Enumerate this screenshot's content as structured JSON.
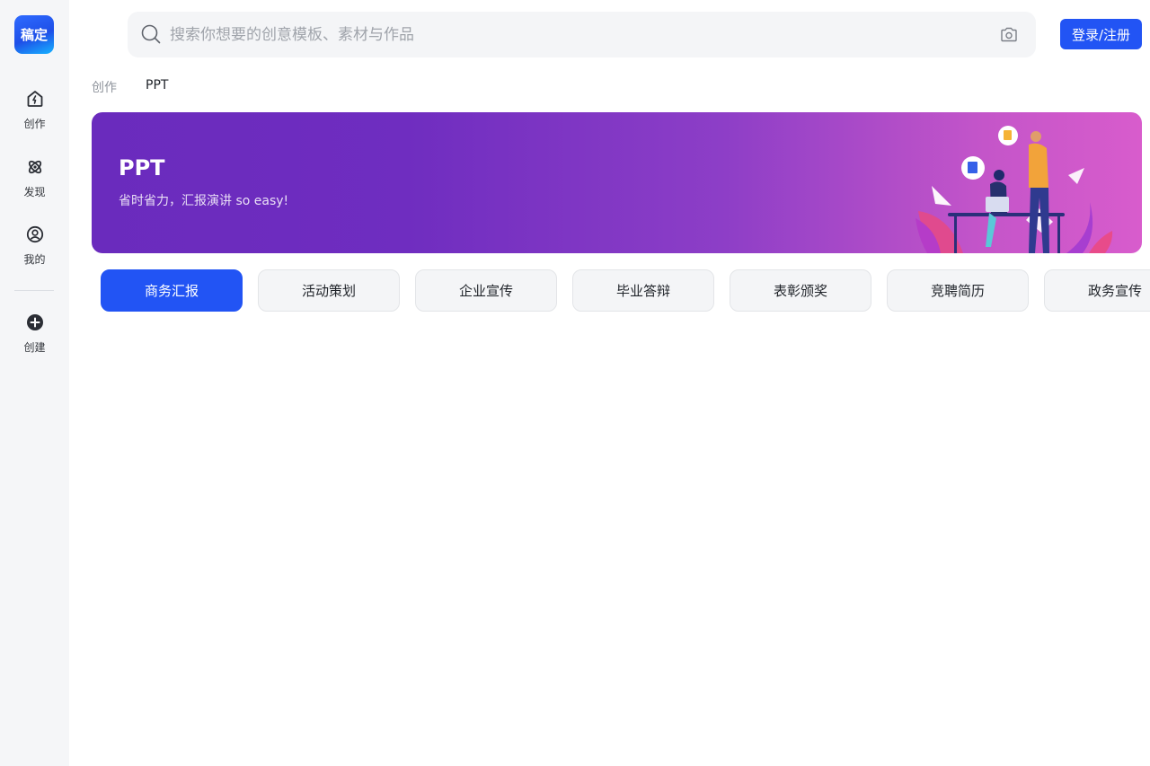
{
  "sidebar": {
    "logo_text": "稿定",
    "items": [
      {
        "label": "创作",
        "icon": "create-icon"
      },
      {
        "label": "发现",
        "icon": "discover-icon"
      },
      {
        "label": "我的",
        "icon": "profile-icon"
      },
      {
        "label": "创建",
        "icon": "add-circle-icon"
      }
    ]
  },
  "header": {
    "search_placeholder": "搜索你想要的创意模板、素材与作品",
    "login_label": "登录/注册"
  },
  "breadcrumb": {
    "parent": "创作",
    "current": "PPT"
  },
  "banner": {
    "title": "PPT",
    "subtitle": "省时省力，汇报演讲 so easy!"
  },
  "tabs": [
    {
      "label": "商务汇报",
      "active": true
    },
    {
      "label": "活动策划",
      "active": false
    },
    {
      "label": "企业宣传",
      "active": false
    },
    {
      "label": "毕业答辩",
      "active": false
    },
    {
      "label": "表彰颁奖",
      "active": false
    },
    {
      "label": "竞聘简历",
      "active": false
    },
    {
      "label": "政务宣传",
      "active": false
    }
  ],
  "colors": {
    "accent": "#2254f4",
    "sidebar_bg": "#f5f6f8",
    "banner_start": "#6a2bbd",
    "banner_end": "#d85ccc"
  }
}
